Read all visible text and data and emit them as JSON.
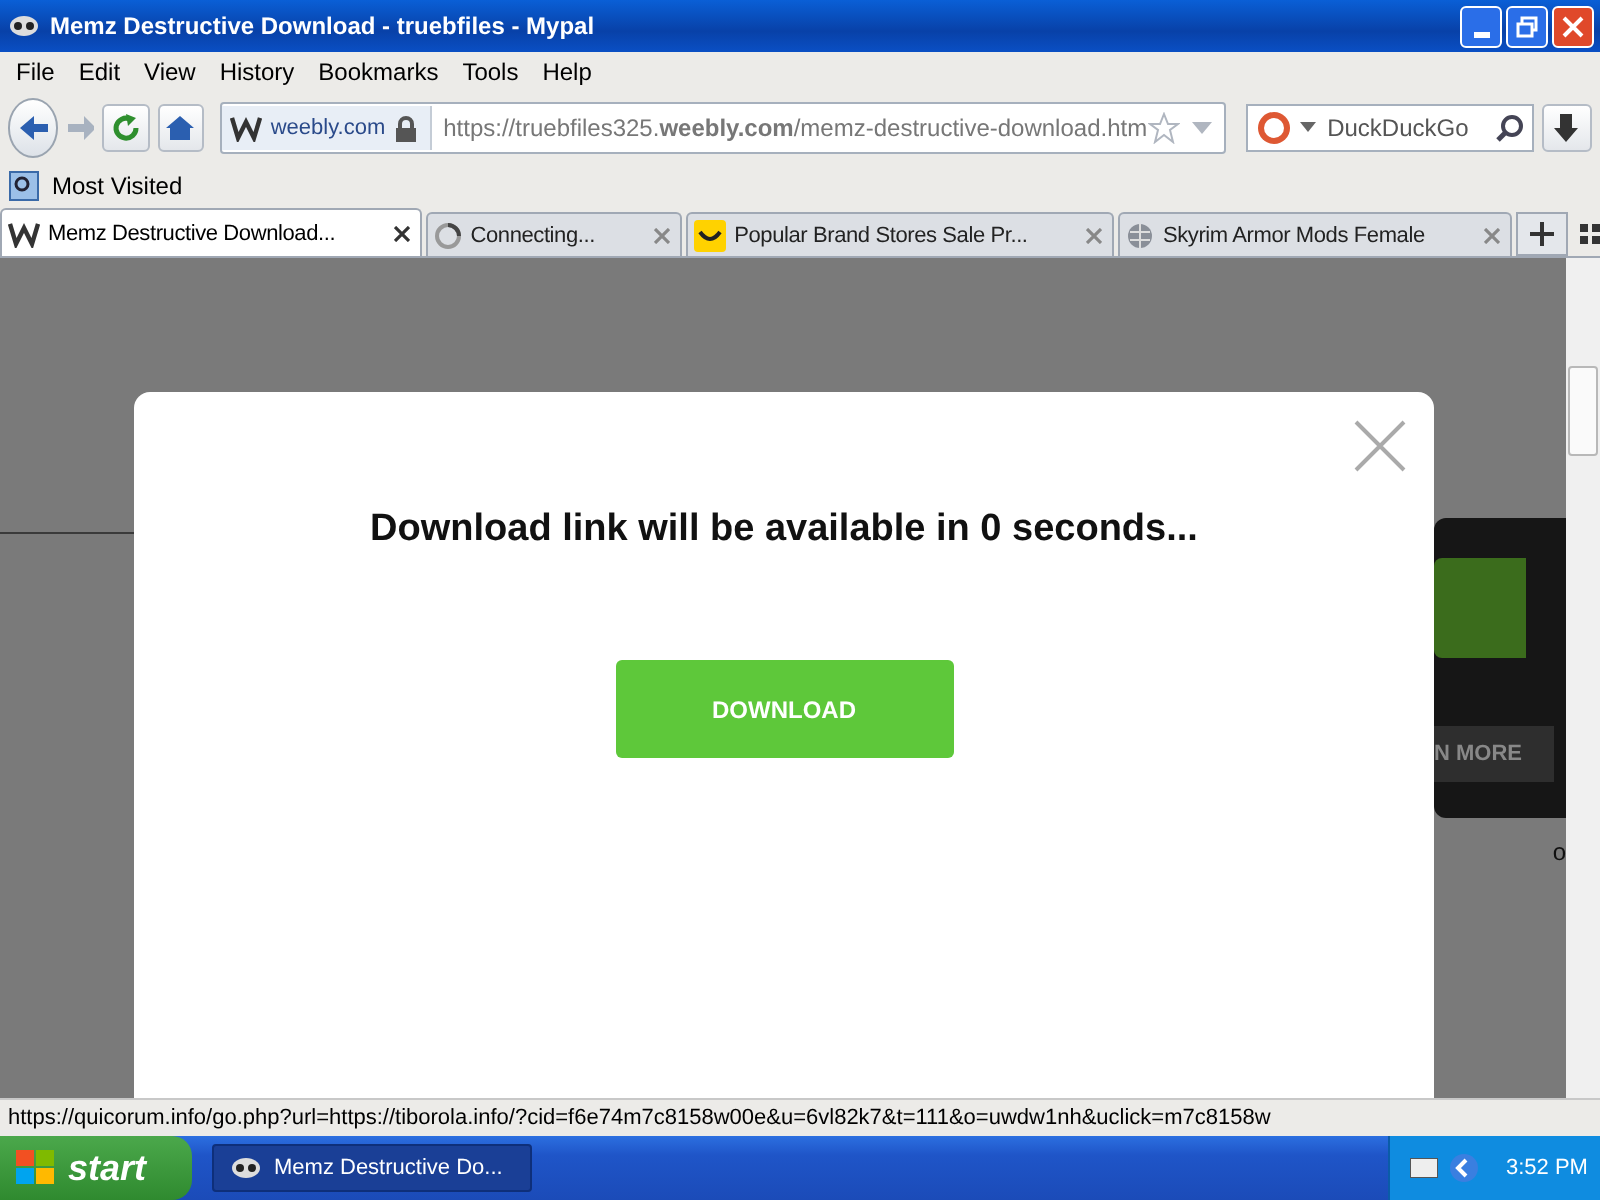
{
  "window": {
    "title": "Memz Destructive Download - truebfiles - Mypal"
  },
  "menu": [
    {
      "label": "File"
    },
    {
      "label": "Edit"
    },
    {
      "label": "View"
    },
    {
      "label": "History"
    },
    {
      "label": "Bookmarks"
    },
    {
      "label": "Tools"
    },
    {
      "label": "Help"
    }
  ],
  "toolbar": {
    "site_badge": "weebly.com",
    "url": "https://truebfiles325.**weebly.com**/memz-destructive-download.htm",
    "search_placeholder": "DuckDuckGo"
  },
  "bookmarks": [
    {
      "label": "Most Visited"
    }
  ],
  "tabs": [
    {
      "label": "Memz Destructive Download...",
      "selected": true,
      "kind": "weebly"
    },
    {
      "label": "Connecting...",
      "selected": false,
      "kind": "loading"
    },
    {
      "label": "Popular Brand Stores Sale Pr...",
      "selected": false,
      "kind": "smile"
    },
    {
      "label": "Skyrim Armor Mods Female",
      "selected": false,
      "kind": "globe"
    }
  ],
  "background_page": {
    "button_text": "N MORE",
    "fragment": "o"
  },
  "dialog": {
    "message": "Download link will be available in 0 seconds...",
    "button": "DOWNLOAD"
  },
  "status_bar": "https://quicorum.info/go.php?url=https://tiborola.info/?cid=f6e74m7c8158w00e&u=6vl82k7&t=111&o=uwdw1nh&uclick=m7c8158w",
  "taskbar": {
    "start": "start",
    "tasks": [
      {
        "label": "Memz Destructive Do...",
        "selected": true
      }
    ],
    "clock": "3:52 PM"
  }
}
